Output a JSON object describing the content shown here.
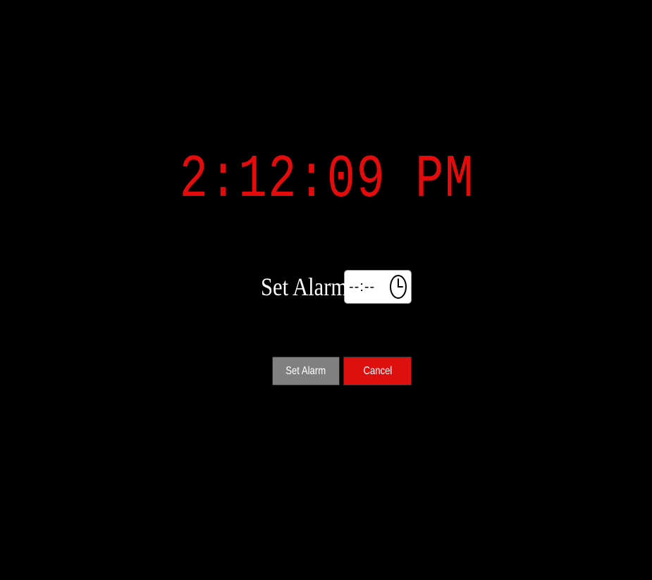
{
  "colors": {
    "background": "#000000",
    "clock": "#e30b0b",
    "set_button": "#808080",
    "cancel_button": "#dd0f0f"
  },
  "clock": {
    "time": "2:12:09 PM"
  },
  "alarm": {
    "label": "Set Alarm :",
    "time_value": "--:--",
    "icon": "clock-icon"
  },
  "buttons": {
    "set_label": "Set Alarm",
    "cancel_label": "Cancel"
  }
}
